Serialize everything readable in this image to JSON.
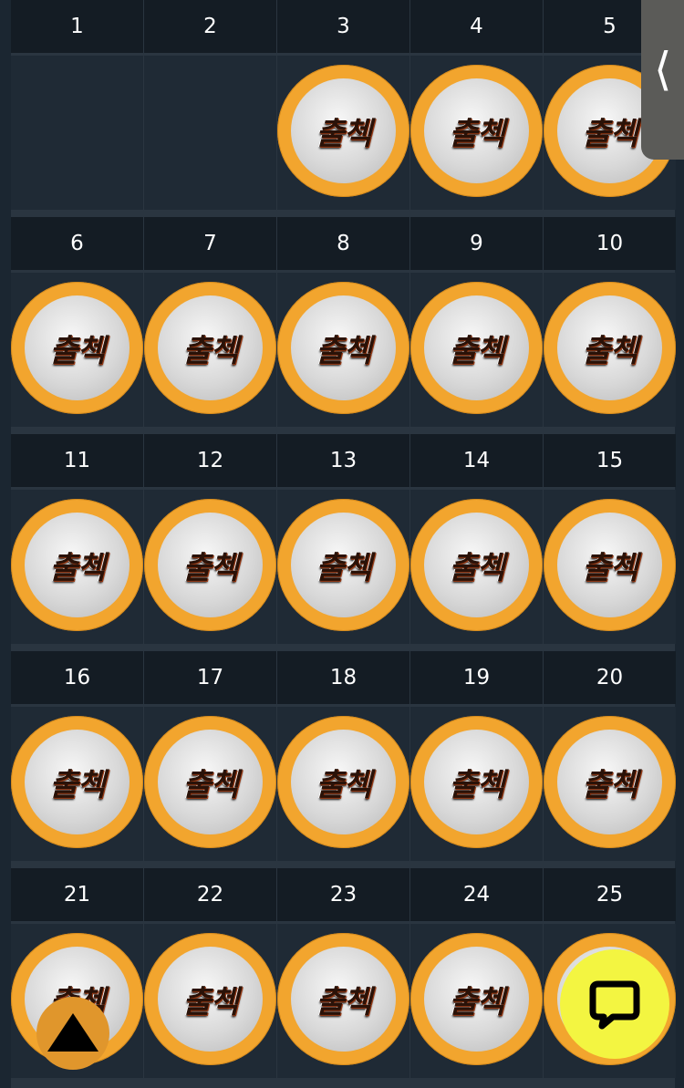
{
  "calendar": {
    "stamp_label": "출첵",
    "days": [
      {
        "day": "1",
        "stamped": false
      },
      {
        "day": "2",
        "stamped": false
      },
      {
        "day": "3",
        "stamped": true
      },
      {
        "day": "4",
        "stamped": true
      },
      {
        "day": "5",
        "stamped": true
      },
      {
        "day": "6",
        "stamped": true
      },
      {
        "day": "7",
        "stamped": true
      },
      {
        "day": "8",
        "stamped": true
      },
      {
        "day": "9",
        "stamped": true
      },
      {
        "day": "10",
        "stamped": true
      },
      {
        "day": "11",
        "stamped": true
      },
      {
        "day": "12",
        "stamped": true
      },
      {
        "day": "13",
        "stamped": true
      },
      {
        "day": "14",
        "stamped": true
      },
      {
        "day": "15",
        "stamped": true
      },
      {
        "day": "16",
        "stamped": true
      },
      {
        "day": "17",
        "stamped": true
      },
      {
        "day": "18",
        "stamped": true
      },
      {
        "day": "19",
        "stamped": true
      },
      {
        "day": "20",
        "stamped": true
      },
      {
        "day": "21",
        "stamped": true
      },
      {
        "day": "22",
        "stamped": true
      },
      {
        "day": "23",
        "stamped": true
      },
      {
        "day": "24",
        "stamped": true
      },
      {
        "day": "25",
        "stamped": true
      }
    ]
  },
  "side_tab": {
    "icon": "chevron-left-icon"
  },
  "scroll_top": {
    "icon": "up-triangle-icon"
  },
  "chat": {
    "icon": "chat-bubble-icon"
  },
  "colors": {
    "stamp_ring": "#f2a52e",
    "chat_button": "#f3f541",
    "header_bg": "#141c24"
  }
}
